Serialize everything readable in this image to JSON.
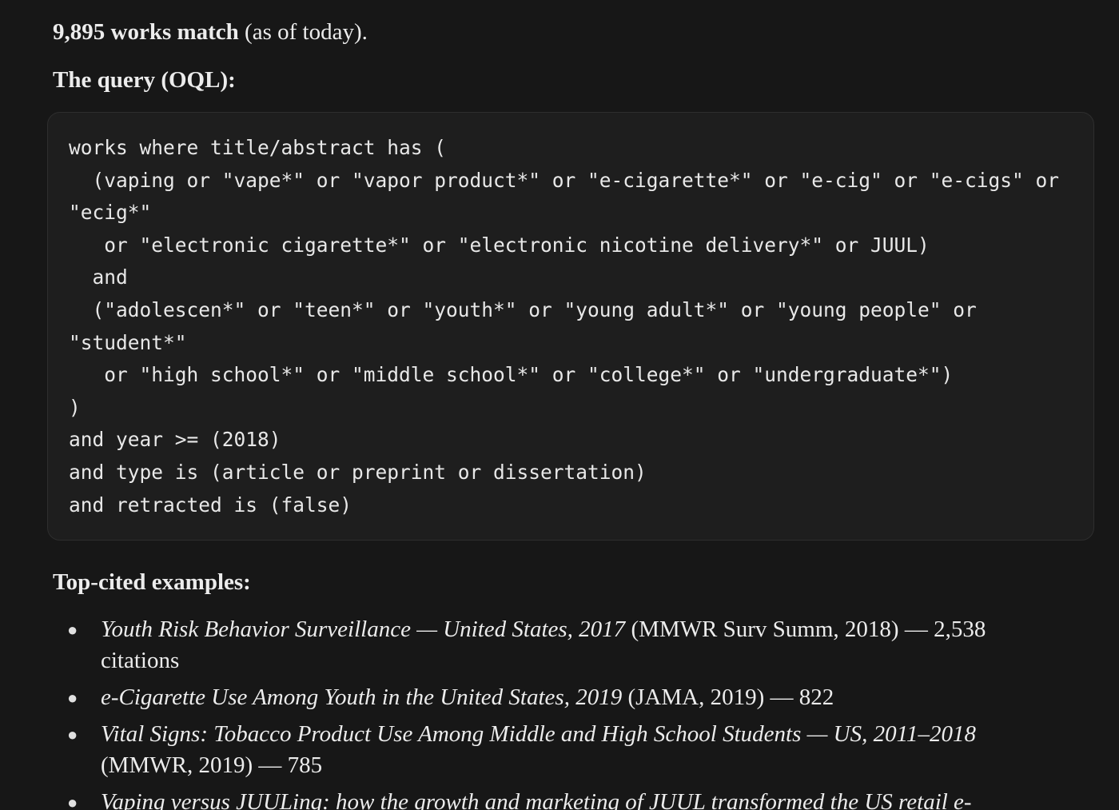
{
  "summary": {
    "count_text": "9,895 works match",
    "suffix": " (as of today)."
  },
  "query_heading": "The query (OQL):",
  "query_lines": [
    "works where title/abstract has (",
    "  (vaping or \"vape*\" or \"vapor product*\" or \"e-cigarette*\" or \"e-cig\" or \"e-cigs\" or",
    "\"ecig*\"",
    "   or \"electronic cigarette*\" or \"electronic nicotine delivery*\" or JUUL)",
    "  and",
    "  (\"adolescen*\" or \"teen*\" or \"youth*\" or \"young adult*\" or \"young people\" or",
    "\"student*\"",
    "   or \"high school*\" or \"middle school*\" or \"college*\" or \"undergraduate*\")",
    ")",
    "and year >= (2018)",
    "and type is (article or preprint or dissertation)",
    "and retracted is (false)"
  ],
  "examples_heading": "Top-cited examples:",
  "examples": [
    {
      "title": "Youth Risk Behavior Surveillance — United States, 2017",
      "details": " (MMWR Surv Summ, 2018) — 2,538 citations"
    },
    {
      "title": "e-Cigarette Use Among Youth in the United States, 2019",
      "details": " (JAMA, 2019) — 822"
    },
    {
      "title": "Vital Signs: Tobacco Product Use Among Middle and High School Students — US, 2011–2018",
      "details": " (MMWR, 2019) — 785"
    },
    {
      "title": "Vaping versus JUULing: how the growth and marketing of JUUL transformed the US retail e-",
      "details": ""
    }
  ]
}
